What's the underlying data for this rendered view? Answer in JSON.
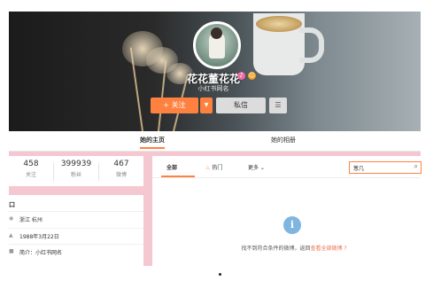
{
  "profile": {
    "name": "花花董花花",
    "intro": "小红书网名",
    "verified_glyph": "♪",
    "badge_glyph": "☺"
  },
  "actions": {
    "follow_label": "+ 关注",
    "dropdown_glyph": "▼",
    "message_label": "私信",
    "menu_glyph": "☰"
  },
  "nav": {
    "home_tab": "她的主页",
    "album_tab": "她的相册"
  },
  "stats": [
    {
      "value": "458",
      "label": "关注"
    },
    {
      "value": "399939",
      "label": "粉丝"
    },
    {
      "value": "467",
      "label": "微博"
    }
  ],
  "info": {
    "title": "口",
    "rows": [
      {
        "icon": "location-icon",
        "glyph": "◉",
        "text": "浙江 杭州"
      },
      {
        "icon": "birthday-icon",
        "glyph": "▲",
        "text": "1988年3月22日"
      },
      {
        "icon": "profile-icon",
        "glyph": "■",
        "text": "简介：小红书网名"
      }
    ]
  },
  "feed": {
    "tabs": {
      "all": "全部",
      "hot": "热门",
      "hot_glyph": "♨",
      "more": "更多 ⌄"
    },
    "search": {
      "value": "葱几",
      "icon": "search-icon"
    },
    "empty": {
      "icon_glyph": "i",
      "message": "找不到符合条件的微博，返回",
      "link": "查看全部微博 ?"
    }
  },
  "colors": {
    "accent": "#ff8140",
    "page_background": "#f5c7d1",
    "link": "#eb7350",
    "info_icon": "#7fb6e0"
  }
}
